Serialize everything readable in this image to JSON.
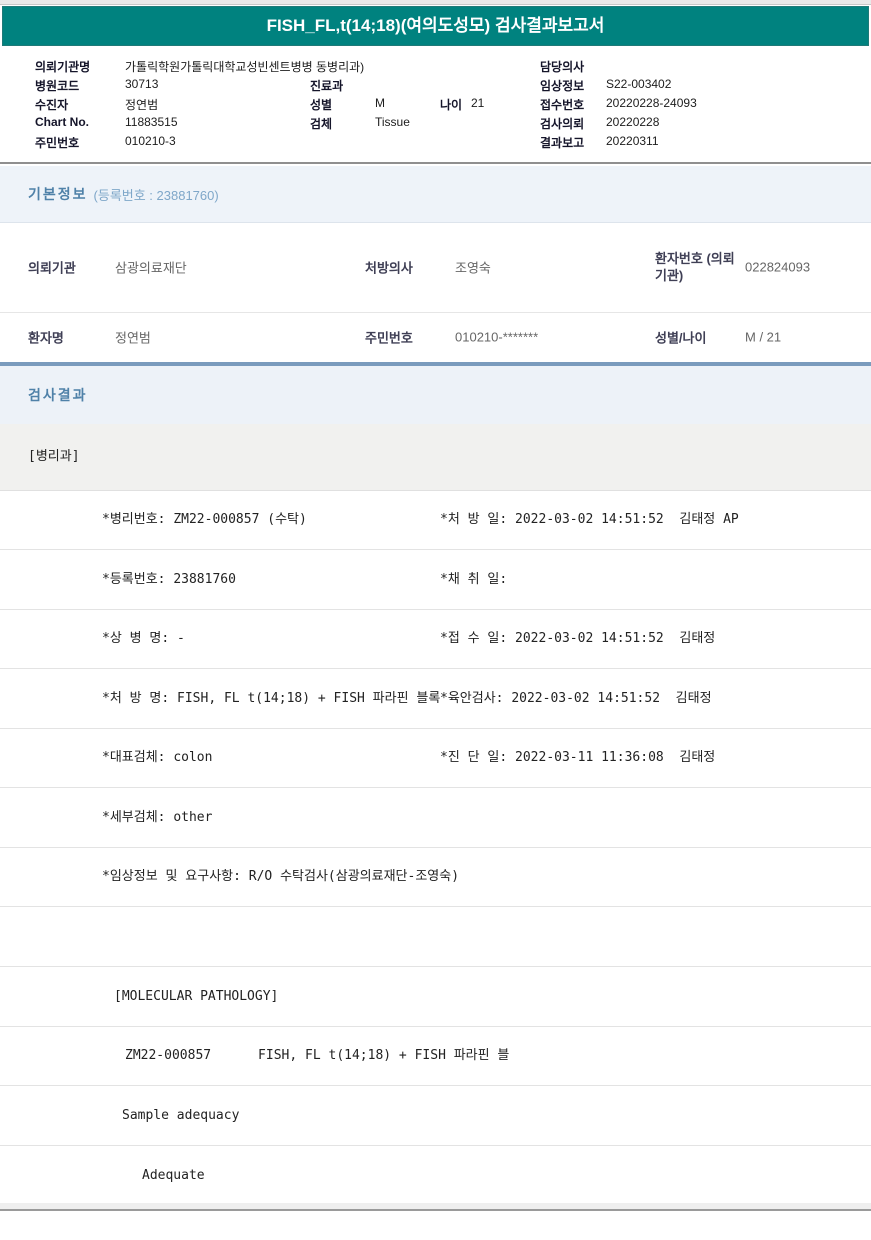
{
  "colors": {
    "banner_teal": "#00827f",
    "section_blue": "#4f81a8",
    "divider_blue": "#7a9bbd"
  },
  "banner": {
    "title": "FISH_FL,t(14;18)(여의도성모) 검사결과보고서"
  },
  "patient_header": {
    "org_label": "의뢰기관명",
    "org_value": "가톨릭학원가톨릭대학교성빈센트병병 동병리과)",
    "hospital_code_label": "병원코드",
    "hospital_code_value": "30713",
    "examinee_label": "수진자",
    "examinee_value": "정연범",
    "chart_no_label": "Chart No.",
    "chart_no_value": "11883515",
    "resident_no_label": "주민번호",
    "resident_no_value": "010210-3",
    "dept_label": "진료과",
    "dept_value": "",
    "sex_label": "성별",
    "sex_value": "M",
    "age_label": "나이",
    "age_value": "21",
    "specimen_label": "검체",
    "specimen_value": "Tissue",
    "doctor_label": "담당의사",
    "doctor_value": "",
    "clinical_info_label": "임상정보",
    "clinical_info_value": "S22-003402",
    "receipt_no_label": "접수번호",
    "receipt_no_value": "20220228-24093",
    "request_date_label": "검사의뢰",
    "request_date_value": "20220228",
    "report_date_label": "결과보고",
    "report_date_value": "20220311"
  },
  "basic_info": {
    "title": "기본정보",
    "title_suffix": "(등록번호 : 23881760)",
    "row1": {
      "c1_label": "의뢰기관",
      "c1_value": "삼광의료재단",
      "c2_label": "처방의사",
      "c2_value": "조영숙",
      "c3_label": "환자번호 (의뢰기관)",
      "c3_value": "022824093"
    },
    "row2": {
      "c1_label": "환자명",
      "c1_value": "정연범",
      "c2_label": "주민번호",
      "c2_value": "010210-*******",
      "c3_label": "성별/나이",
      "c3_value": "M / 21"
    }
  },
  "results": {
    "title": "검사결과",
    "department": "[병리과]",
    "rows": [
      {
        "left": "*병리번호: ZM22-000857 (수탁)",
        "right": "*처 방 일: 2022-03-02 14:51:52  김태정 AP"
      },
      {
        "left": "*등록번호: 23881760",
        "right": "*채 취 일:"
      },
      {
        "left": "*상 병 명: -",
        "right": "*접 수 일: 2022-03-02 14:51:52  김태정"
      },
      {
        "left": "*처 방 명: FISH, FL t(14;18) + FISH 파라핀 블록",
        "right": "*육안검사: 2022-03-02 14:51:52  김태정"
      },
      {
        "left": "*대표검체: colon",
        "right": "*진 단 일: 2022-03-11 11:36:08  김태정"
      },
      {
        "left": "*세부검체: other",
        "right": ""
      },
      {
        "left": "*임상정보 및 요구사항: R/O 수탁검사(삼광의료재단-조영숙)",
        "right": ""
      },
      {
        "left": "",
        "right": ""
      },
      {
        "left": "[MOLECULAR PATHOLOGY]",
        "right": ""
      },
      {
        "left": "ZM22-000857      FISH, FL t(14;18) + FISH 파라핀 블",
        "right": ""
      },
      {
        "left": "Sample adequacy",
        "right": ""
      },
      {
        "left": "Adequate",
        "right": ""
      }
    ]
  }
}
